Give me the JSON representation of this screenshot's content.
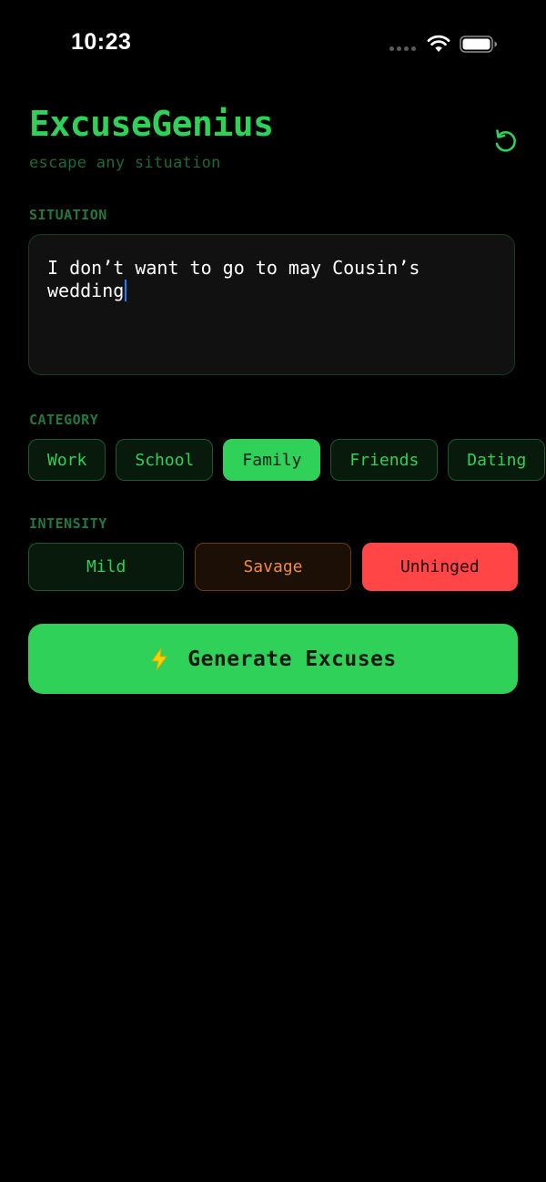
{
  "status_bar": {
    "time": "10:23"
  },
  "header": {
    "title": "ExcuseGenius",
    "subtitle": "escape any situation",
    "reset_icon": "refresh-icon"
  },
  "situation": {
    "label": "SITUATION",
    "value": "I don’t want to go to may Cousin’s\nwedding"
  },
  "category": {
    "label": "CATEGORY",
    "options": [
      "Work",
      "School",
      "Family",
      "Friends",
      "Dating"
    ],
    "selected": "Family"
  },
  "intensity": {
    "label": "INTENSITY",
    "options": [
      "Mild",
      "Savage",
      "Unhinged"
    ],
    "selected": "Unhinged"
  },
  "generate": {
    "label": "Generate Excuses",
    "icon": "lightning-icon"
  },
  "colors": {
    "accent": "#30d158",
    "savage": "#f08c3c",
    "unhinged": "#ff4545",
    "caret": "#1a7cff"
  }
}
